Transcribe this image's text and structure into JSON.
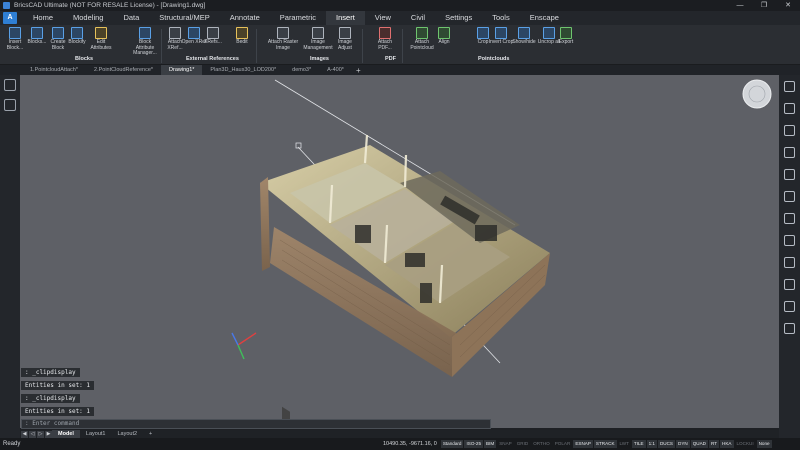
{
  "window": {
    "title": "BricsCAD Ultimate (NOT FOR RESALE License) - [Drawing1.dwg]",
    "controls": [
      "—",
      "❐",
      "✕"
    ]
  },
  "ribbon": {
    "app_button": "A",
    "tabs": [
      "Home",
      "Modeling",
      "Data",
      "Structural/MEP",
      "Annotate",
      "Parametric",
      "Insert",
      "View",
      "Civil",
      "Settings",
      "Tools",
      "Enscape"
    ],
    "active_tab": "Insert",
    "items": [
      {
        "label": "Insert Block...",
        "icon": "insert-block-icon"
      },
      {
        "label": "Blocks...",
        "icon": "blocks-icon"
      },
      {
        "label": "Create Block",
        "icon": "create-block-icon"
      },
      {
        "label": "Blockify",
        "icon": "blockify-icon"
      },
      {
        "label": "Edit Attributes",
        "icon": "edit-attributes-icon"
      },
      {
        "label": "Block Attribute Manager...",
        "icon": "block-attribute-manager-icon"
      },
      {
        "label": "Attach XRef...",
        "icon": "attach-xref-icon"
      },
      {
        "label": "Open XRef",
        "icon": "open-xref-icon"
      },
      {
        "label": "XRefs...",
        "icon": "xrefs-icon"
      },
      {
        "label": "Bedit",
        "icon": "bedit-icon"
      },
      {
        "label": "Attach Raster Image",
        "icon": "attach-raster-image-icon"
      },
      {
        "label": "Image Management",
        "icon": "image-management-icon"
      },
      {
        "label": "Image Adjust",
        "icon": "image-adjust-icon"
      },
      {
        "label": "Attach PDF...",
        "icon": "attach-pdf-icon"
      },
      {
        "label": "Attach Pointcloud",
        "icon": "attach-pointcloud-icon"
      },
      {
        "label": "Align",
        "icon": "align-icon"
      },
      {
        "label": "Crop",
        "icon": "crop-icon"
      },
      {
        "label": "Invert Crop",
        "icon": "invert-crop-icon"
      },
      {
        "label": "Show/hide",
        "icon": "show-hide-icon"
      },
      {
        "label": "Uncrop all",
        "icon": "uncrop-all-icon"
      },
      {
        "label": "Export",
        "icon": "export-icon"
      }
    ],
    "groups": [
      "Blocks",
      "External References",
      "Images",
      "PDF",
      "Pointclouds"
    ]
  },
  "doc_tabs": [
    "1.PointcloudAttach*",
    "2.PointCloudReference*",
    "Drawing1*",
    "Plan3D_Haus30_LOD200*",
    "demo3*",
    "A-400*"
  ],
  "active_doc_tab": "Drawing1*",
  "command_history": [
    " : _clipdisplay",
    "Entities in set: 1",
    " : _clipdisplay",
    "Entities in set: 1"
  ],
  "command_prompt": ": Enter command",
  "layout_tabs": [
    "Model",
    "Layout1",
    "Layout2"
  ],
  "layout_add": "+",
  "status": {
    "ready": "Ready",
    "coords": "10490.35, -9671.16, 0",
    "buttons": [
      {
        "label": "Standard",
        "on": true
      },
      {
        "label": "ISO-25",
        "on": true
      },
      {
        "label": "BIM",
        "on": true
      },
      {
        "label": "SNAP",
        "on": false
      },
      {
        "label": "GRID",
        "on": false
      },
      {
        "label": "ORTHO",
        "on": false
      },
      {
        "label": "POLAR",
        "on": false
      },
      {
        "label": "ESNAP",
        "on": true
      },
      {
        "label": "STRACK",
        "on": true
      },
      {
        "label": "LWT",
        "on": false
      },
      {
        "label": "TILE",
        "on": true
      },
      {
        "label": "1:1",
        "on": true
      },
      {
        "label": "DUCS",
        "on": true
      },
      {
        "label": "DYN",
        "on": true
      },
      {
        "label": "QUAD",
        "on": true
      },
      {
        "label": "RT",
        "on": true
      },
      {
        "label": "HKA",
        "on": true
      },
      {
        "label": "LOCKUI",
        "on": false
      },
      {
        "label": "None",
        "on": true
      }
    ]
  }
}
